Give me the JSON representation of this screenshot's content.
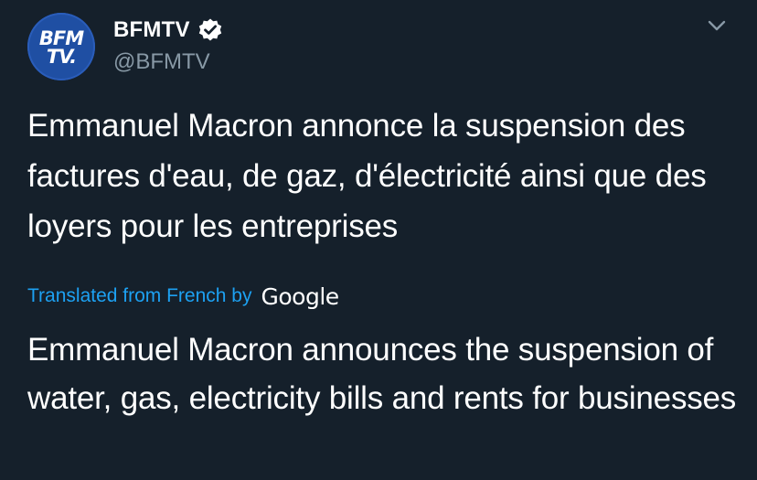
{
  "tweet": {
    "avatar": {
      "logo_line1": "BFM",
      "logo_line2": "TV."
    },
    "author": {
      "display_name": "BFMTV",
      "handle": "@BFMTV",
      "verified": true,
      "verified_icon": "verified-badge-icon"
    },
    "menu_icon": "chevron-down-icon",
    "text": "Emmanuel Macron annonce la suspension des factures d'eau, de gaz, d'électricité ainsi que des loyers pour les entreprises",
    "translation": {
      "label": "Translated from French by",
      "provider": "Google",
      "text": "Emmanuel Macron announces the suspension of water, gas, electricity bills and rents for businesses"
    }
  },
  "colors": {
    "background": "#15202b",
    "text": "#ffffff",
    "secondary_text": "#8899a6",
    "link": "#1da1f2",
    "avatar_bg": "#1f4fa3"
  }
}
